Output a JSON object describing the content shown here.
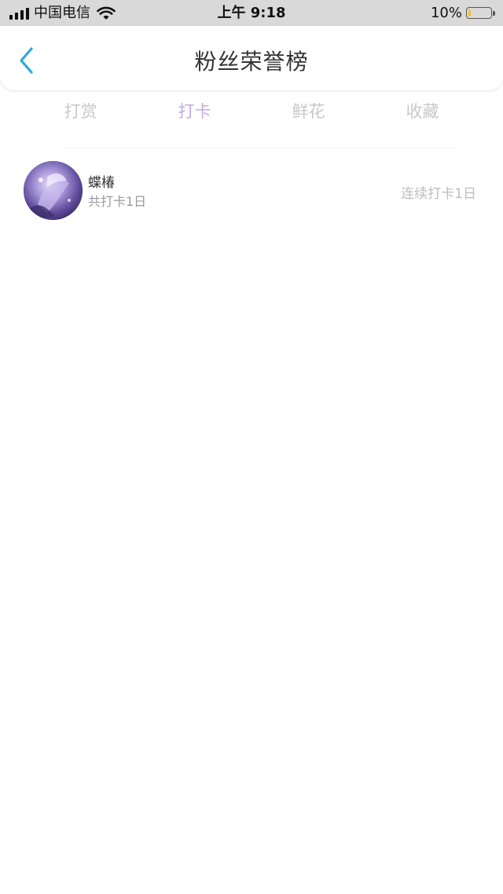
{
  "status_bar": {
    "carrier": "中国电信",
    "time": "上午 9:18",
    "battery_pct": "10%",
    "battery_level": 0.1
  },
  "nav": {
    "title": "粉丝荣誉榜",
    "back_icon": "chevron-left-icon",
    "accent": "#2ea7e0"
  },
  "tabs": [
    {
      "label": "打赏",
      "active": false
    },
    {
      "label": "打卡",
      "active": true
    },
    {
      "label": "鲜花",
      "active": false
    },
    {
      "label": "收藏",
      "active": false
    }
  ],
  "colors": {
    "active_tab": "#c9a9e6",
    "inactive_tab": "#c8c8c8"
  },
  "list": [
    {
      "name": "蝶椿",
      "total": "共打卡1日",
      "streak": "连续打卡1日"
    }
  ]
}
